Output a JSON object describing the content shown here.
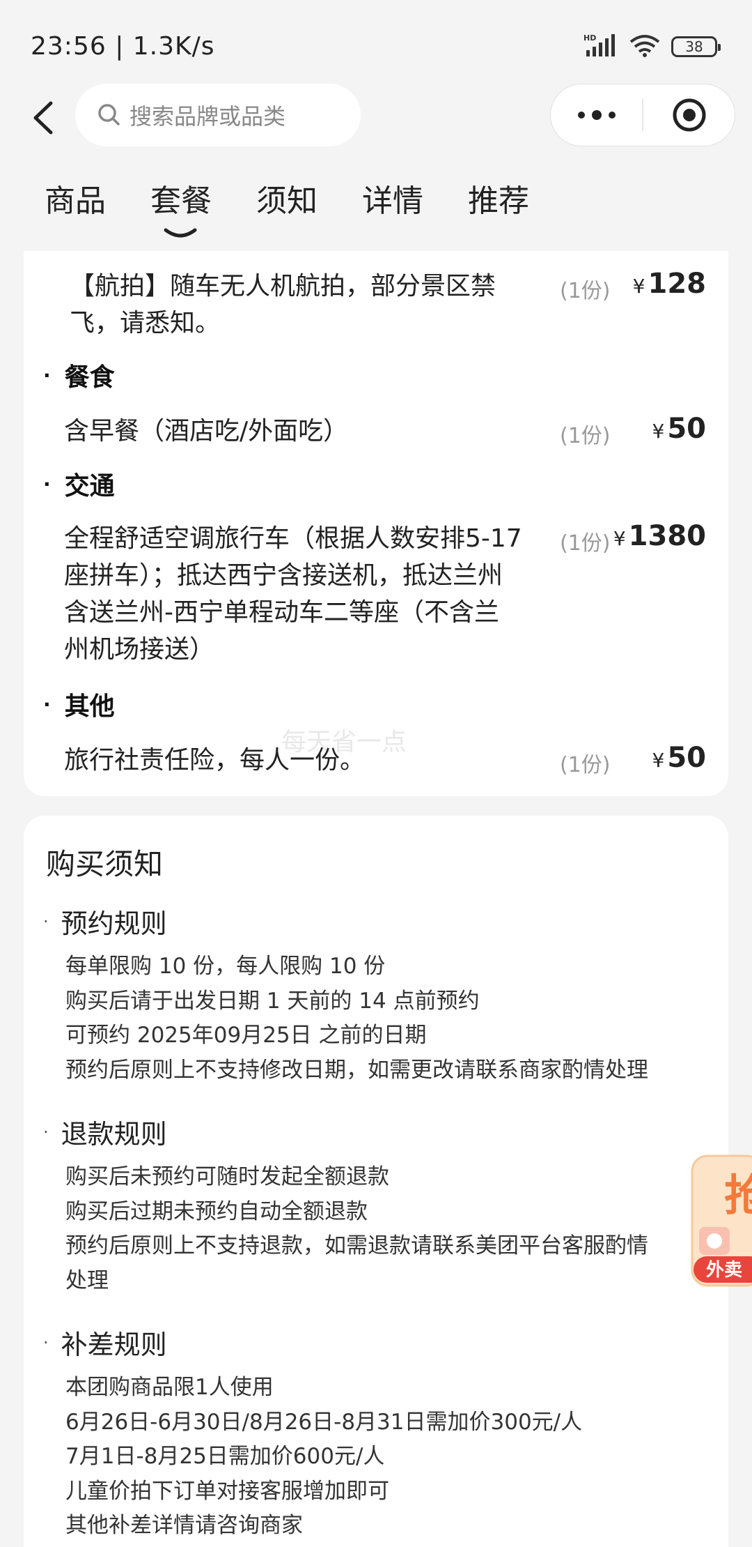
{
  "status": {
    "time": "23:56 | 1.3K/s",
    "battery": "38",
    "network": "HD"
  },
  "nav": {
    "search_placeholder": "搜索品牌或品类"
  },
  "tabs": [
    "商品",
    "套餐",
    "须知",
    "详情",
    "推荐"
  ],
  "active_tab": "套餐",
  "package": {
    "aerial": {
      "lines": [
        "【航拍】随车无人机航拍，部分景区禁",
        "飞，请悉知。"
      ],
      "qty": "(1份)",
      "currency": "¥",
      "price": "128"
    },
    "categories": {
      "food": "餐食",
      "transport": "交通",
      "other": "其他"
    },
    "food_item": {
      "text": "含早餐（酒店吃/外面吃）",
      "qty": "(1份)",
      "currency": "¥",
      "price": "50"
    },
    "transport_item": {
      "lines": [
        "全程舒适空调旅行车（根据人数安排5-17",
        "座拼车）；抵达西宁含接送机，抵达兰州",
        "含送兰州-西宁单程动车二等座（不含兰",
        "州机场接送）"
      ],
      "qty": "(1份)",
      "currency": "¥",
      "price": "1380"
    },
    "other_item": {
      "text": "旅行社责任险，每人一份。",
      "qty": "(1份)",
      "currency": "¥",
      "price": "50"
    },
    "watermark": "每天省一点"
  },
  "notice": {
    "title": "购买须知",
    "booking": {
      "title": "预约规则",
      "lines": [
        "每单限购 10 份，每人限购 10 份",
        "购买后请于出发日期 1 天前的 14 点前预约",
        "可预约 2025年09月25日 之前的日期",
        "预约后原则上不支持修改日期，如需更改请联系商家酌情处理"
      ]
    },
    "refund": {
      "title": "退款规则",
      "lines": [
        "购买后未预约可随时发起全额退款",
        "购买后过期未预约自动全额退款",
        "预约后原则上不支持退款，如需退款请联系美团平台客服酌情",
        "处理"
      ]
    },
    "supplement": {
      "title": "补差规则",
      "lines": [
        "本团购商品限1人使用",
        "6月26日-6月30日/8月26日-8月31日需加价300元/人",
        "7月1日-8月25日需加价600元/人",
        "儿童价拍下订单对接客服增加即可",
        "其他补差详情请咨询商家"
      ]
    }
  },
  "float_ad": {
    "big_char": "抢",
    "label": "外卖"
  },
  "colors": {
    "ad_orange": "#f47a3a",
    "ad_red": "#e8453c",
    "tab_underline": "#222222"
  }
}
